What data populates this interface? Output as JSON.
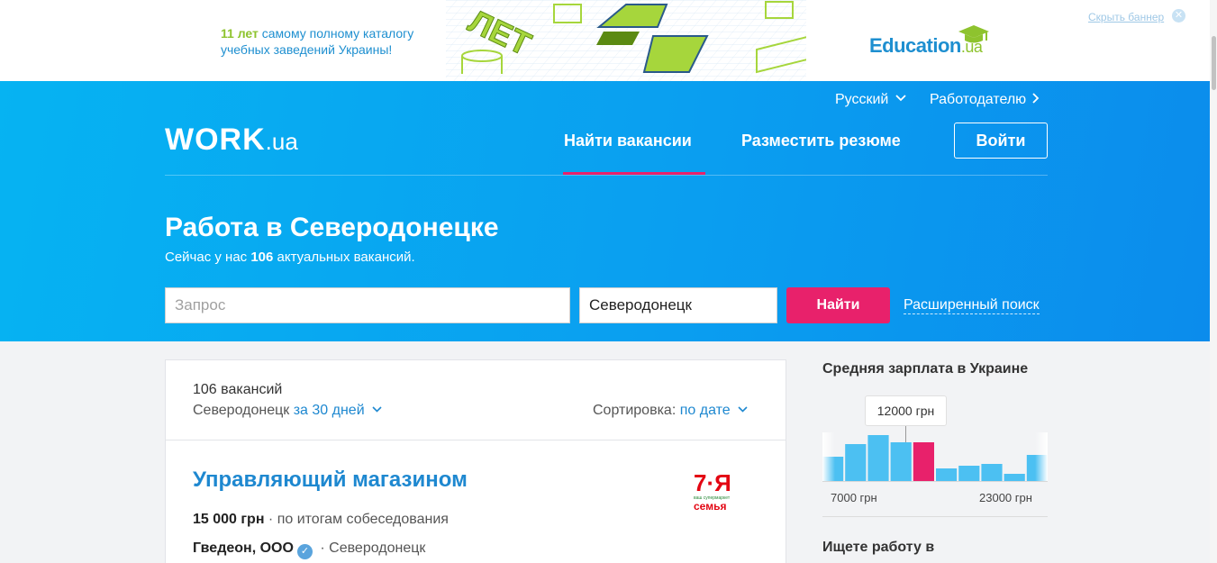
{
  "banner": {
    "line1_highlight": "11 лет",
    "line1_rest": " самому полному каталогу",
    "line2": "учебных заведений Украины!",
    "art_text": "ЛЕТ",
    "brand": "Education",
    "brand_suffix": ".ua",
    "hide_label": "Скрыть баннер",
    "close_glyph": "✕"
  },
  "header": {
    "language": "Русский",
    "language_chevron": "⌄",
    "employer": "Работодателю",
    "employer_chevron": "›",
    "logo_main": "WORK",
    "logo_suffix": ".ua",
    "nav_find": "Найти вакансии",
    "nav_resume": "Разместить резюме",
    "login": "Войти"
  },
  "hero": {
    "title": "Работа в Северодонецке",
    "subtitle_pre": "Сейчас у нас ",
    "subtitle_count": "106",
    "subtitle_post": " актуальных вакансий.",
    "query_placeholder": "Запрос",
    "city_value": "Северодонецк",
    "search_label": "Найти",
    "advanced_search": "Расширенный поиск"
  },
  "results": {
    "count_label": "106 вакансий",
    "city": "Северодонецк",
    "period": "за 30 дней",
    "sort_label": "Сортировка:",
    "sort_value": "по дате",
    "chevron": "⌄"
  },
  "job": {
    "title": "Управляющий магазином",
    "salary": "15 000 грн",
    "salary_note": " · по итогам собеседования",
    "company": "Гведеон, ООО",
    "verified_glyph": "✓",
    "location": " · Северодонецк",
    "logo_text": "7·Я",
    "logo_small": "ваш супермаркет",
    "logo_word": "семья"
  },
  "sidebar": {
    "title": "Средняя зарплата в Украине",
    "tooltip": "12000 грн",
    "tick_left": "7000 грн",
    "tick_right": "23000 грн",
    "title2": "Ищете работу в"
  },
  "chart_data": {
    "type": "bar",
    "title": "Средняя зарплата в Украине",
    "values": [
      27,
      41,
      51,
      43,
      43,
      14,
      17,
      19,
      8,
      29
    ],
    "highlight_index": 4,
    "highlight_label": "12000 грн",
    "x_ticks": [
      "7000 грн",
      "23000 грн"
    ],
    "colors": {
      "bar": "#4cc0f2",
      "highlight": "#e8216b"
    }
  },
  "colors": {
    "accent": "#e8216b",
    "hero": "#0a9ff0",
    "link": "#1e88d0"
  }
}
